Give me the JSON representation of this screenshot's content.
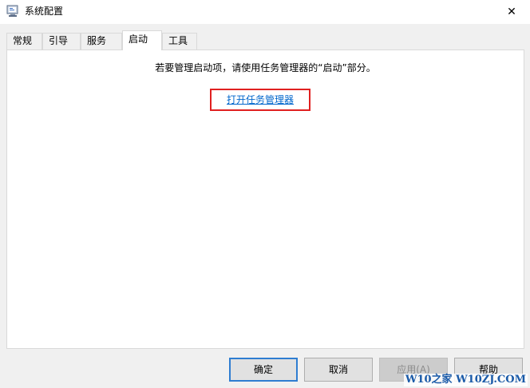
{
  "window": {
    "title": "系统配置",
    "icon": "msconfig-app-icon",
    "close_glyph": "✕"
  },
  "tabs": [
    {
      "label": "常规",
      "active": false
    },
    {
      "label": "引导",
      "active": false
    },
    {
      "label": "服务",
      "active": false
    },
    {
      "label": "启动",
      "active": true
    },
    {
      "label": "工具",
      "active": false
    }
  ],
  "startup": {
    "info": "若要管理启动项，请使用任务管理器的“启动”部分。",
    "link": "打开任务管理器"
  },
  "buttons": {
    "ok": "确定",
    "cancel": "取消",
    "apply": "应用(A)",
    "help": "帮助"
  },
  "watermark": "W10之家 W10ZJ.COM",
  "colors": {
    "link": "#0066cc",
    "highlight_box": "#e02020",
    "default_button_border": "#2e7dd1"
  }
}
